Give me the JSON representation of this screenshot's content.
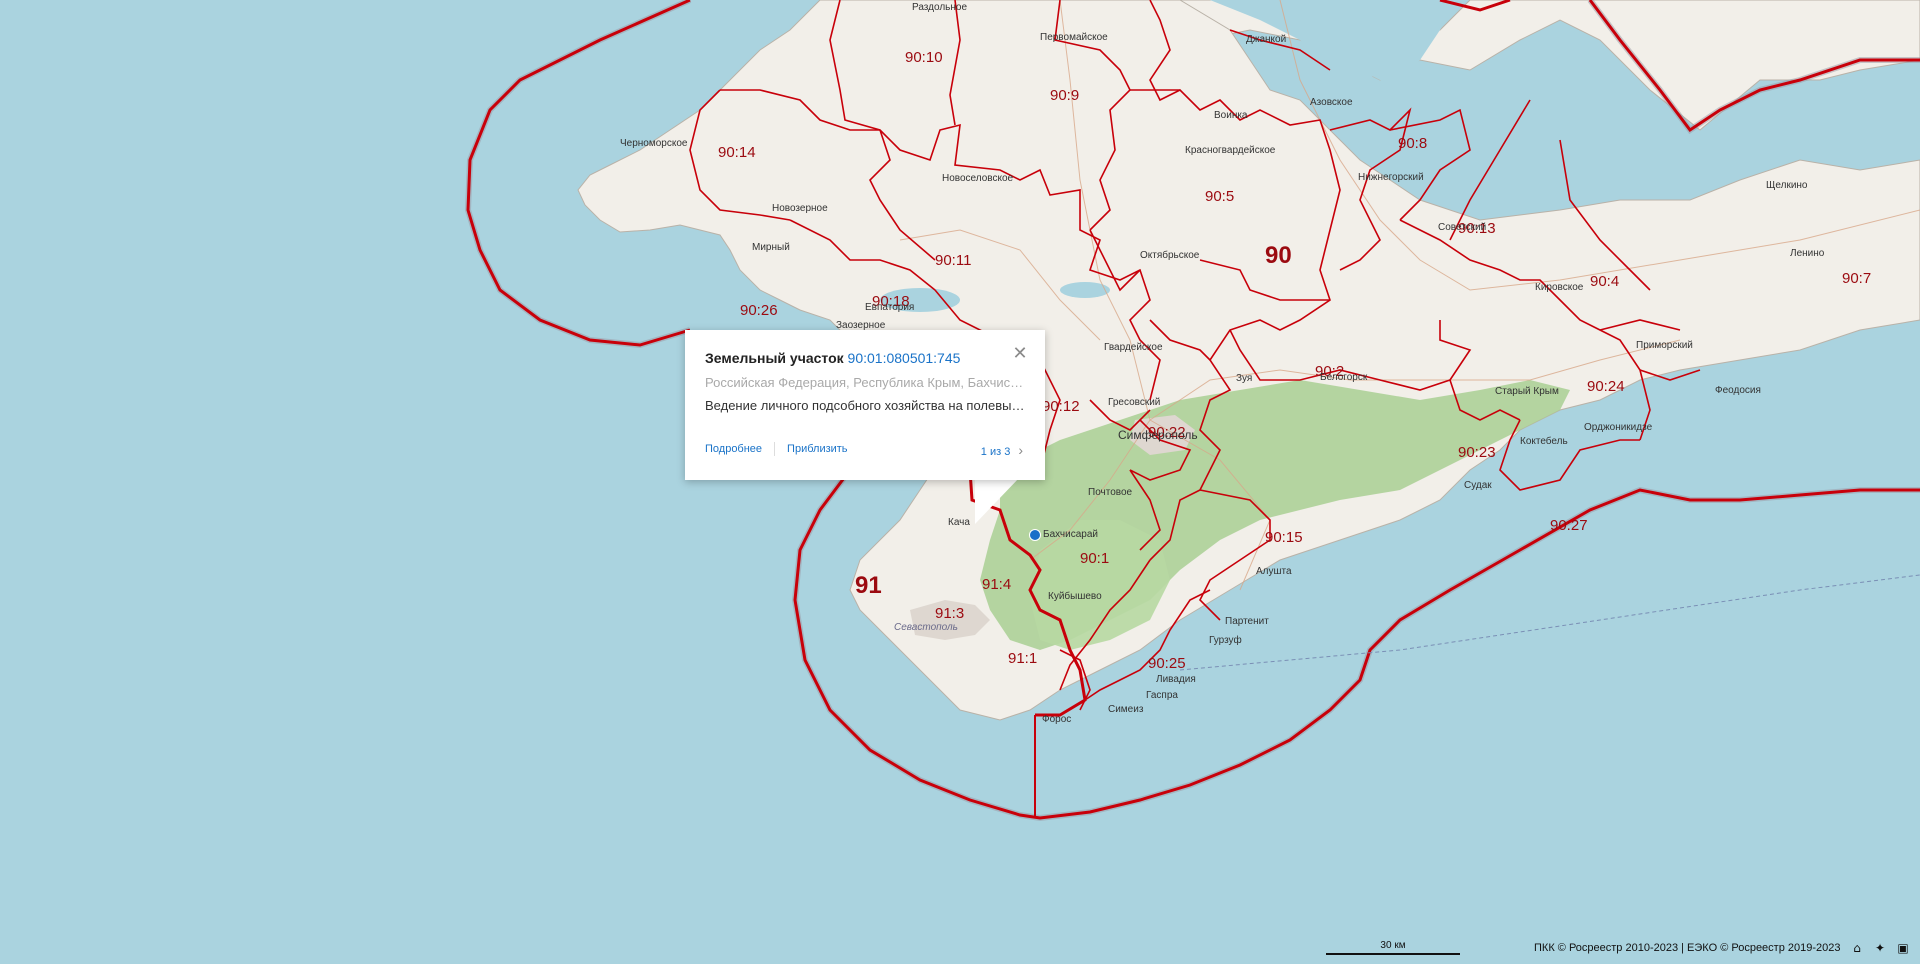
{
  "popup": {
    "title_prefix": "Земельный участок",
    "cadastral_number": "90:01:080501:745",
    "address": "Российская Федерация, Республика Крым, Бахчисарайский район",
    "description": "Ведение личного подсобного хозяйства на полевых участках",
    "link_details": "Подробнее",
    "link_zoom": "Приблизить",
    "pager": "1 из 3",
    "close_icon": "close-icon",
    "next_icon": "chevron-right-icon"
  },
  "districts": [
    {
      "id": "90",
      "label": "90"
    },
    {
      "id": "91",
      "label": "91"
    },
    {
      "id": "90:1",
      "label": "90:1"
    },
    {
      "id": "90:2",
      "label": "90:2"
    },
    {
      "id": "90:4",
      "label": "90:4"
    },
    {
      "id": "90:5",
      "label": "90:5"
    },
    {
      "id": "90:7",
      "label": "90:7"
    },
    {
      "id": "90:8",
      "label": "90:8"
    },
    {
      "id": "90:9",
      "label": "90:9"
    },
    {
      "id": "90:10",
      "label": "90:10"
    },
    {
      "id": "90:11",
      "label": "90:11"
    },
    {
      "id": "90:12",
      "label": "90:12"
    },
    {
      "id": "90:13",
      "label": "90:13"
    },
    {
      "id": "90:14",
      "label": "90:14"
    },
    {
      "id": "90:15",
      "label": "90:15"
    },
    {
      "id": "90:18",
      "label": "90:18"
    },
    {
      "id": "90:22",
      "label": "90:22"
    },
    {
      "id": "90:23",
      "label": "90:23"
    },
    {
      "id": "90:24",
      "label": "90:24"
    },
    {
      "id": "90:25",
      "label": "90:25"
    },
    {
      "id": "90:26",
      "label": "90:26"
    },
    {
      "id": "90:27",
      "label": "90:27"
    },
    {
      "id": "91:1",
      "label": "91:1"
    },
    {
      "id": "91:3",
      "label": "91:3"
    },
    {
      "id": "91:4",
      "label": "91:4"
    }
  ],
  "places": [
    "Раздольное",
    "Первомайское",
    "Джанкой",
    "Азовское",
    "Черноморское",
    "Воинка",
    "Красногвардейское",
    "Нижнегорский",
    "Новоселовское",
    "Новозерное",
    "Мирный",
    "Октябрьское",
    "Советский",
    "Щелкино",
    "Ленино",
    "Кировское",
    "Евпатория",
    "Заозерное",
    "Гвардейское",
    "Приморский",
    "Зуя",
    "Белогорск",
    "Старый Крым",
    "Гресовский",
    "Симферополь",
    "Феодосия",
    "Коктебель",
    "Орджоникидзе",
    "Почтовое",
    "Судак",
    "Кача",
    "Бахчисарай",
    "Алушта",
    "Куйбышево",
    "Севастополь",
    "Партенит",
    "Гурзуф",
    "Ливадия",
    "Гаспра",
    "Симеиз",
    "Форос"
  ],
  "scale_label": "30 км",
  "copyright": "ПКК © Росреестр 2010-2023 | ЕЭКО © Росреестр 2019-2023",
  "controls": [
    "home-icon",
    "locate-icon",
    "layers-icon"
  ],
  "colors": {
    "sea": "#aad3df",
    "land": "#f2efe9",
    "forest": "#a9cf93",
    "boundary": "#c8000a",
    "link": "#1a73c8",
    "marker": "#1a6fc8"
  }
}
